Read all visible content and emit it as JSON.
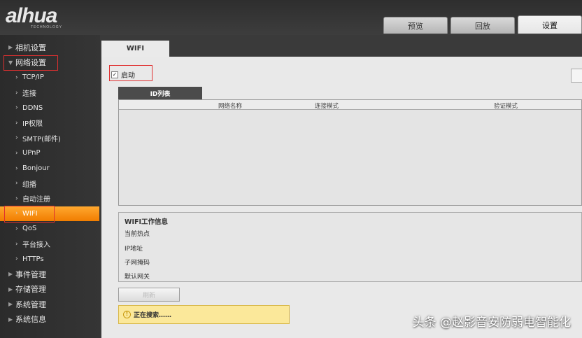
{
  "header": {
    "logo": "alhua",
    "logo_sub": "TECHNOLOGY",
    "tabs": [
      {
        "label": "预览",
        "active": false
      },
      {
        "label": "回放",
        "active": false
      },
      {
        "label": "设置",
        "active": true
      }
    ]
  },
  "sidebar": {
    "items": [
      {
        "label": "相机设置",
        "level": "top",
        "active": false
      },
      {
        "label": "网络设置",
        "level": "top",
        "active": false,
        "expanded": true
      },
      {
        "label": "TCP/IP",
        "level": "sub",
        "active": false
      },
      {
        "label": "连接",
        "level": "sub",
        "active": false
      },
      {
        "label": "DDNS",
        "level": "sub",
        "active": false
      },
      {
        "label": "IP权限",
        "level": "sub",
        "active": false
      },
      {
        "label": "SMTP(邮件)",
        "level": "sub",
        "active": false
      },
      {
        "label": "UPnP",
        "level": "sub",
        "active": false
      },
      {
        "label": "Bonjour",
        "level": "sub",
        "active": false
      },
      {
        "label": "组播",
        "level": "sub",
        "active": false
      },
      {
        "label": "自动注册",
        "level": "sub",
        "active": false
      },
      {
        "label": "WIFI",
        "level": "sub",
        "active": true
      },
      {
        "label": "QoS",
        "level": "sub",
        "active": false
      },
      {
        "label": "平台接入",
        "level": "sub",
        "active": false
      },
      {
        "label": "HTTPs",
        "level": "sub",
        "active": false
      },
      {
        "label": "事件管理",
        "level": "top",
        "active": false
      },
      {
        "label": "存储管理",
        "level": "top",
        "active": false
      },
      {
        "label": "系统管理",
        "level": "top",
        "active": false
      },
      {
        "label": "系统信息",
        "level": "top",
        "active": false
      }
    ]
  },
  "main": {
    "page_tab": "WIFI",
    "enable_label": "启动",
    "enable_checked": true,
    "list_tab": "ID列表",
    "columns": [
      "网络名称",
      "连接模式",
      "验证模式"
    ],
    "info_title": "WIFI工作信息",
    "info_rows": [
      "当前热点",
      "IP地址",
      "子网掩码",
      "默认网关"
    ],
    "refresh_label": "刷新",
    "status_text": "正在搜索……"
  },
  "watermark": "头条 @赵影音安防弱电智能化",
  "colors": {
    "accent": "#f28a10",
    "highlight_box": "#e03030",
    "status_bg": "#fbe89a"
  }
}
